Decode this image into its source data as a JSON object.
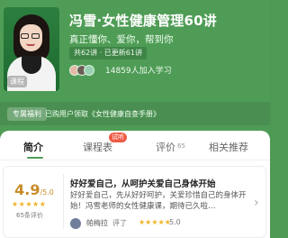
{
  "course": {
    "title": "冯雪·女性健康管理60讲",
    "subtitle": "真正懂你、爱你，帮到你",
    "badge": "共62讲 · 已更新61讲",
    "learners": "14859人加入学习",
    "cover_tag": "课程"
  },
  "benefit": {
    "label": "专属福利",
    "text": "已购用户领取《女性健康自查手册》"
  },
  "tabs": [
    {
      "label": "简介"
    },
    {
      "label": "课程表",
      "badge": "试听"
    },
    {
      "label": "评价",
      "count": "65"
    },
    {
      "label": "相关推荐"
    }
  ],
  "review": {
    "score": "4.9",
    "scale": "/5.0",
    "count_text": "65条评价",
    "title": "好好爱自己，从呵护关爱自己身体开始",
    "body": "好好爱自己，先从好好呵护，关爱珍惜自己的身体开始！冯雪老师的女性健康课，期待已久啦…",
    "reviewer": "帕梅拉",
    "meta": "评了",
    "review_score": "5.0"
  },
  "colors": {
    "header": "#4f9c56",
    "accent": "#c98d28",
    "trial_badge": "#ef5a46"
  }
}
